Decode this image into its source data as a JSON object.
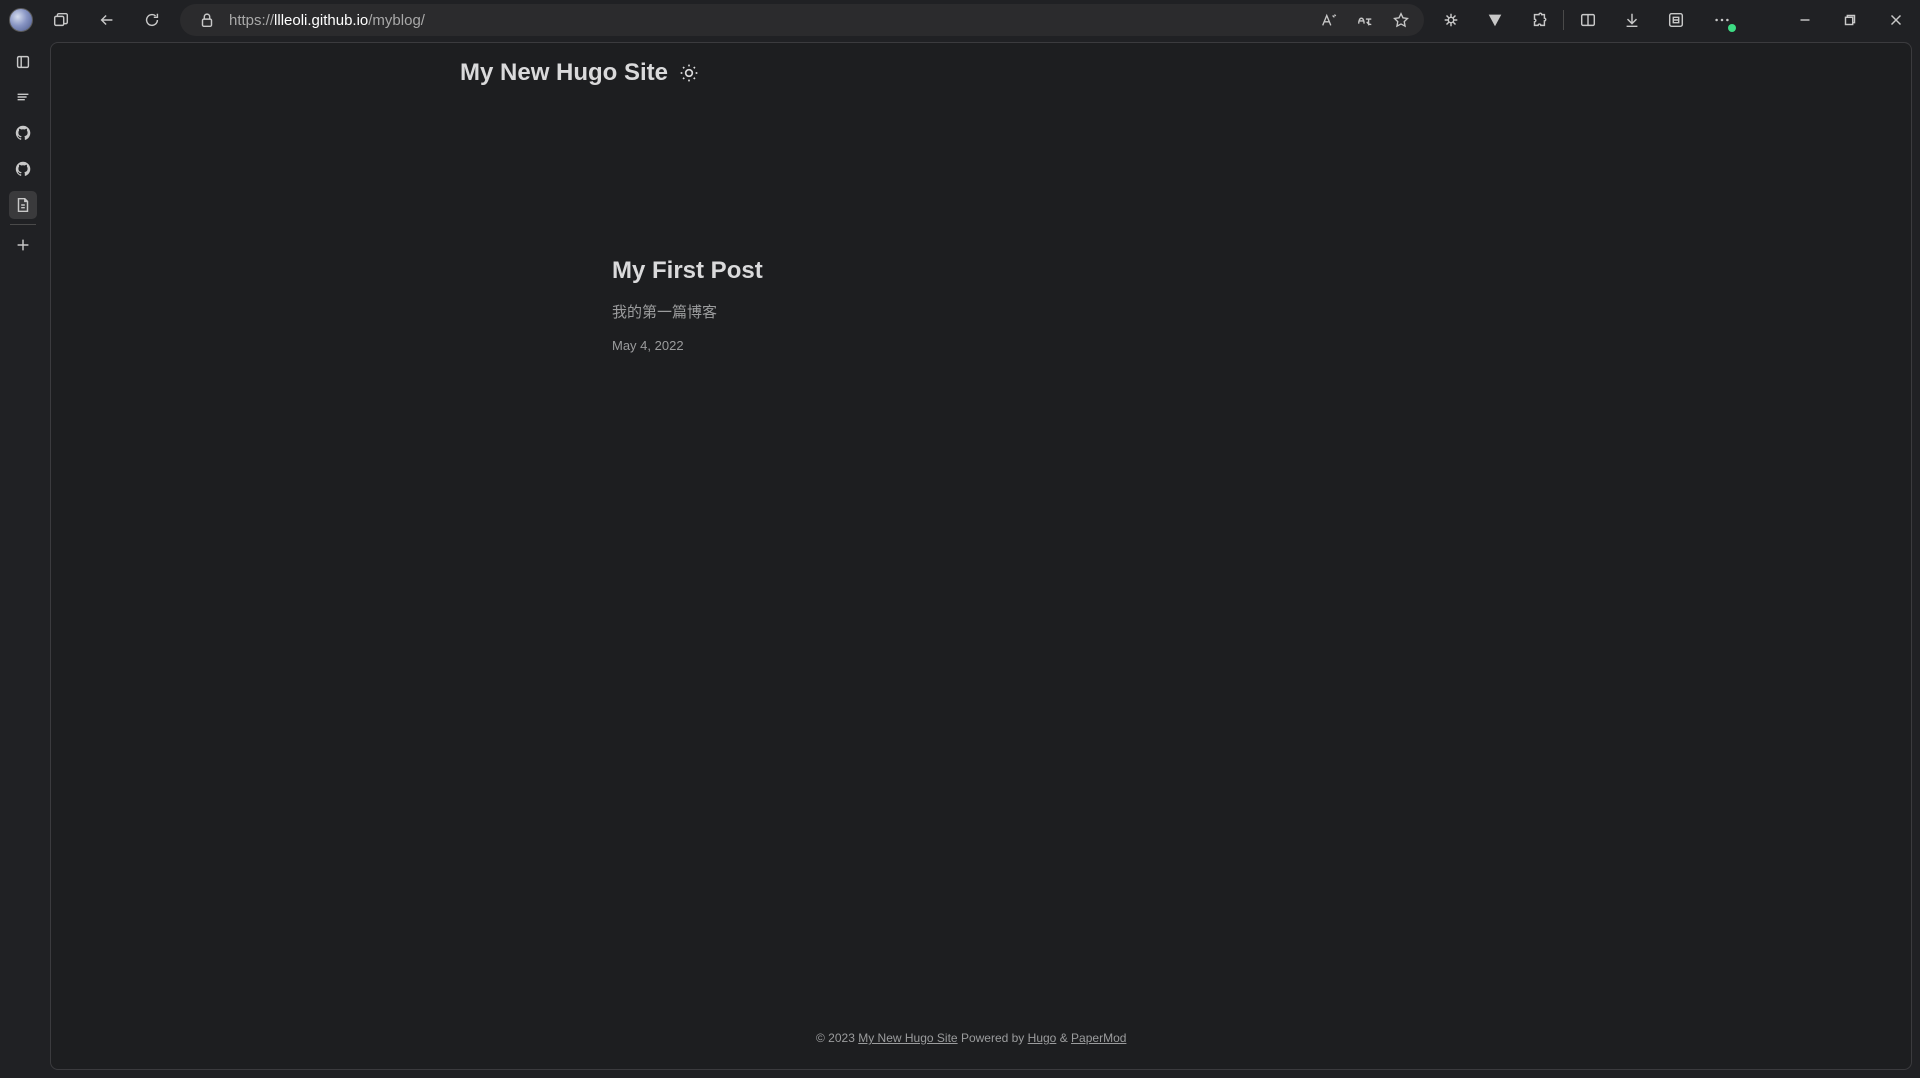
{
  "browser": {
    "url_scheme": "https://",
    "url_host": "llleoli.github.io",
    "url_path": "/myblog/",
    "icons": {
      "profile": "profile-avatar",
      "tabs": "workspaces-icon",
      "back": "back-arrow-icon",
      "refresh": "refresh-icon",
      "lock": "lock-icon",
      "read_aloud": "read-aloud-icon",
      "translate": "translate-icon",
      "favorite": "star-icon",
      "extension1": "extension-icon",
      "extension2": "vpn-icon",
      "extensions": "puzzle-icon",
      "split": "split-screen-icon",
      "downloads": "download-icon",
      "collections": "collections-icon",
      "more": "more-icon",
      "minimize": "minimize-icon",
      "restore": "restore-icon",
      "close": "close-icon"
    }
  },
  "sidebar": {
    "items": [
      {
        "name": "tab-actions-icon"
      },
      {
        "name": "vertical-tabs-icon"
      },
      {
        "name": "github-icon"
      },
      {
        "name": "github-icon"
      },
      {
        "name": "document-icon"
      },
      {
        "name": "add-icon"
      }
    ]
  },
  "site": {
    "title": "My New Hugo Site",
    "theme_toggle_icon": "sun-icon"
  },
  "posts": [
    {
      "title": "My First Post",
      "summary": "我的第一篇博客",
      "date": "May 4, 2022"
    }
  ],
  "footer": {
    "copyright": "© 2023",
    "site_link": "My New Hugo Site",
    "powered_by": "Powered by",
    "hugo_link": "Hugo",
    "ampersand": "&",
    "papermod_link": "PaperMod"
  },
  "colors": {
    "page_background": "#1d1e20",
    "chrome_background": "#202124",
    "primary_text": "#dadadb",
    "secondary_text": "#9b9c9d",
    "notification_dot": "#3ddc84"
  }
}
